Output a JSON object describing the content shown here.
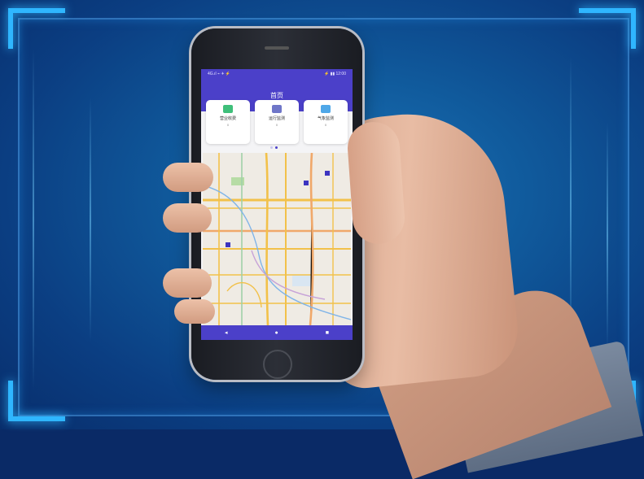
{
  "phone_app": {
    "status_bar": {
      "left": "4G.ıl ⌁ ✈ ⚡",
      "right": "⚡ ▮▮ 12:00"
    },
    "header": {
      "title": "首页"
    },
    "cards": [
      {
        "label": "营业收费",
        "value": "0",
        "icon_color": "#3fbf7a",
        "icon": "chart-icon"
      },
      {
        "label": "运行监测",
        "value": "0",
        "icon_color": "#6f76c8",
        "icon": "monitor-icon"
      },
      {
        "label": "气象监测",
        "value": "0",
        "icon_color": "#4fa7e8",
        "icon": "cloud-icon"
      }
    ],
    "pager": {
      "count": 2,
      "active": 1
    },
    "nav": {
      "back": "◂",
      "home": "●",
      "recent": "■"
    }
  },
  "colors": {
    "app_primary": "#4b40c9",
    "background_glow": "#1b74b8",
    "frame_corner": "#2fb6ff"
  }
}
